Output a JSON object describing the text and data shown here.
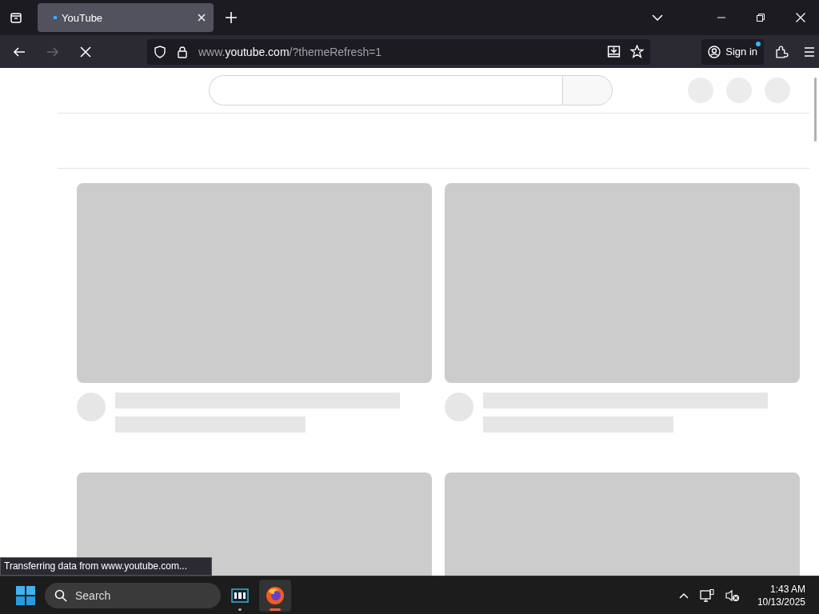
{
  "tabs": [
    {
      "title": "YouTube",
      "selected": true,
      "loading": true
    }
  ],
  "toolbar": {
    "forward_disabled": true,
    "loading": true,
    "url": {
      "prefix": "www.",
      "domain": "youtube.com",
      "path": "/?themeRefresh=1"
    },
    "sign_in": {
      "label": "Sign in",
      "notification": true
    }
  },
  "page": {
    "cards": [
      {
        "kind": "skeleton"
      },
      {
        "kind": "skeleton"
      },
      {
        "kind": "thumbnail_only"
      },
      {
        "kind": "thumbnail_only"
      }
    ]
  },
  "status_text": "Transferring data from www.youtube.com...",
  "taskbar": {
    "search_placeholder": "Search",
    "apps": [
      {
        "kind": "film",
        "selected": false,
        "running": true
      },
      {
        "kind": "browser",
        "selected": true,
        "running": true
      }
    ],
    "time": "1:43 AM",
    "date": "10/13/2025"
  }
}
